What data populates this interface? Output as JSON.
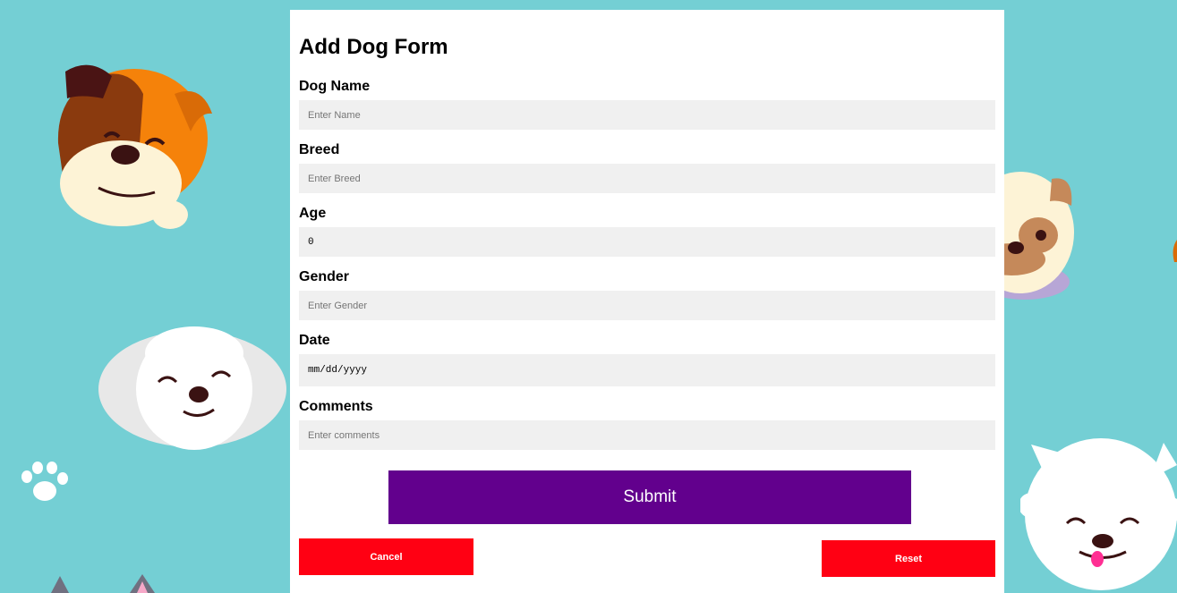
{
  "form": {
    "title": "Add Dog Form",
    "fields": [
      {
        "label": "Dog Name",
        "placeholder": "Enter Name",
        "value": ""
      },
      {
        "label": "Breed",
        "placeholder": "Enter Breed",
        "value": ""
      },
      {
        "label": "Age",
        "placeholder": "",
        "value": "0"
      },
      {
        "label": "Gender",
        "placeholder": "Enter Gender",
        "value": ""
      },
      {
        "label": "Date",
        "placeholder": "",
        "value": "mm/dd/yyyy"
      },
      {
        "label": "Comments",
        "placeholder": "Enter comments",
        "value": ""
      }
    ],
    "submit_label": "Submit",
    "cancel_label": "Cancel",
    "reset_label": "Reset"
  },
  "colors": {
    "background": "#74cfd4",
    "submit": "#62008d",
    "danger": "#ff0013",
    "input_bg": "#f0f0f0"
  },
  "decorations": [
    "bulldog-illustration",
    "pug-illustration",
    "maltese-illustration",
    "paw-print-icon",
    "white-fluffy-dog-illustration",
    "dog-ears-illustration"
  ]
}
